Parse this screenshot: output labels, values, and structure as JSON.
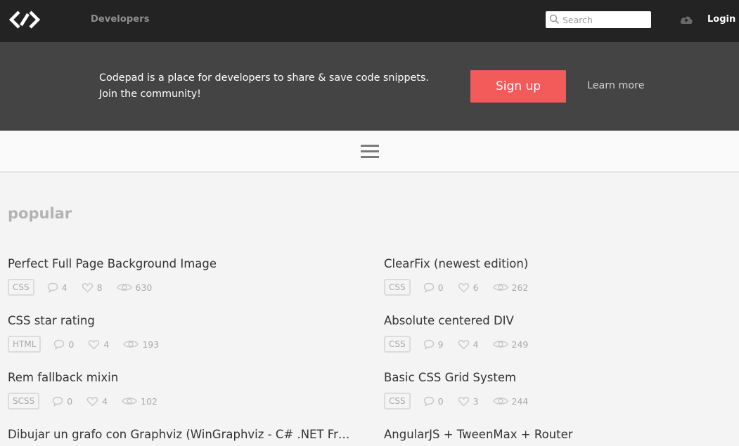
{
  "header": {
    "nav_developers": "Developers",
    "search_placeholder": "Search",
    "login_label": "Login"
  },
  "banner": {
    "text": "Codepad is a place for developers to share & save code snippets. Join the community!",
    "signup_label": "Sign up",
    "learn_more_label": "Learn more"
  },
  "section": {
    "title": "popular"
  },
  "snippets": [
    {
      "title": "Perfect Full Page Background Image",
      "tag": "CSS",
      "comments": "4",
      "likes": "8",
      "views": "630"
    },
    {
      "title": "ClearFix (newest edition)",
      "tag": "CSS",
      "comments": "0",
      "likes": "6",
      "views": "262"
    },
    {
      "title": "CSS star rating",
      "tag": "HTML",
      "comments": "0",
      "likes": "4",
      "views": "193"
    },
    {
      "title": "Absolute centered DIV",
      "tag": "CSS",
      "comments": "9",
      "likes": "4",
      "views": "249"
    },
    {
      "title": "Rem fallback mixin",
      "tag": "SCSS",
      "comments": "0",
      "likes": "4",
      "views": "102"
    },
    {
      "title": "Basic CSS Grid System",
      "tag": "CSS",
      "comments": "0",
      "likes": "3",
      "views": "244"
    },
    {
      "title": "Dibujar un grafo con Graphviz (WinGraphviz - C# .NET Framework)",
      "tag": "",
      "comments": "",
      "likes": "",
      "views": ""
    },
    {
      "title": "AngularJS + TweenMax + Router",
      "tag": "",
      "comments": "",
      "likes": "",
      "views": ""
    }
  ],
  "icons": {
    "logo": "codepad-logo-icon",
    "search": "search-icon",
    "cloud": "cloud-upload-icon",
    "menu": "hamburger-menu-icon",
    "comment": "comment-icon",
    "like": "heart-icon",
    "views": "eye-icon"
  },
  "colors": {
    "topbar": "#232323",
    "banner": "#444444",
    "signup": "#f35b5b",
    "page": "#f4f4f4"
  }
}
